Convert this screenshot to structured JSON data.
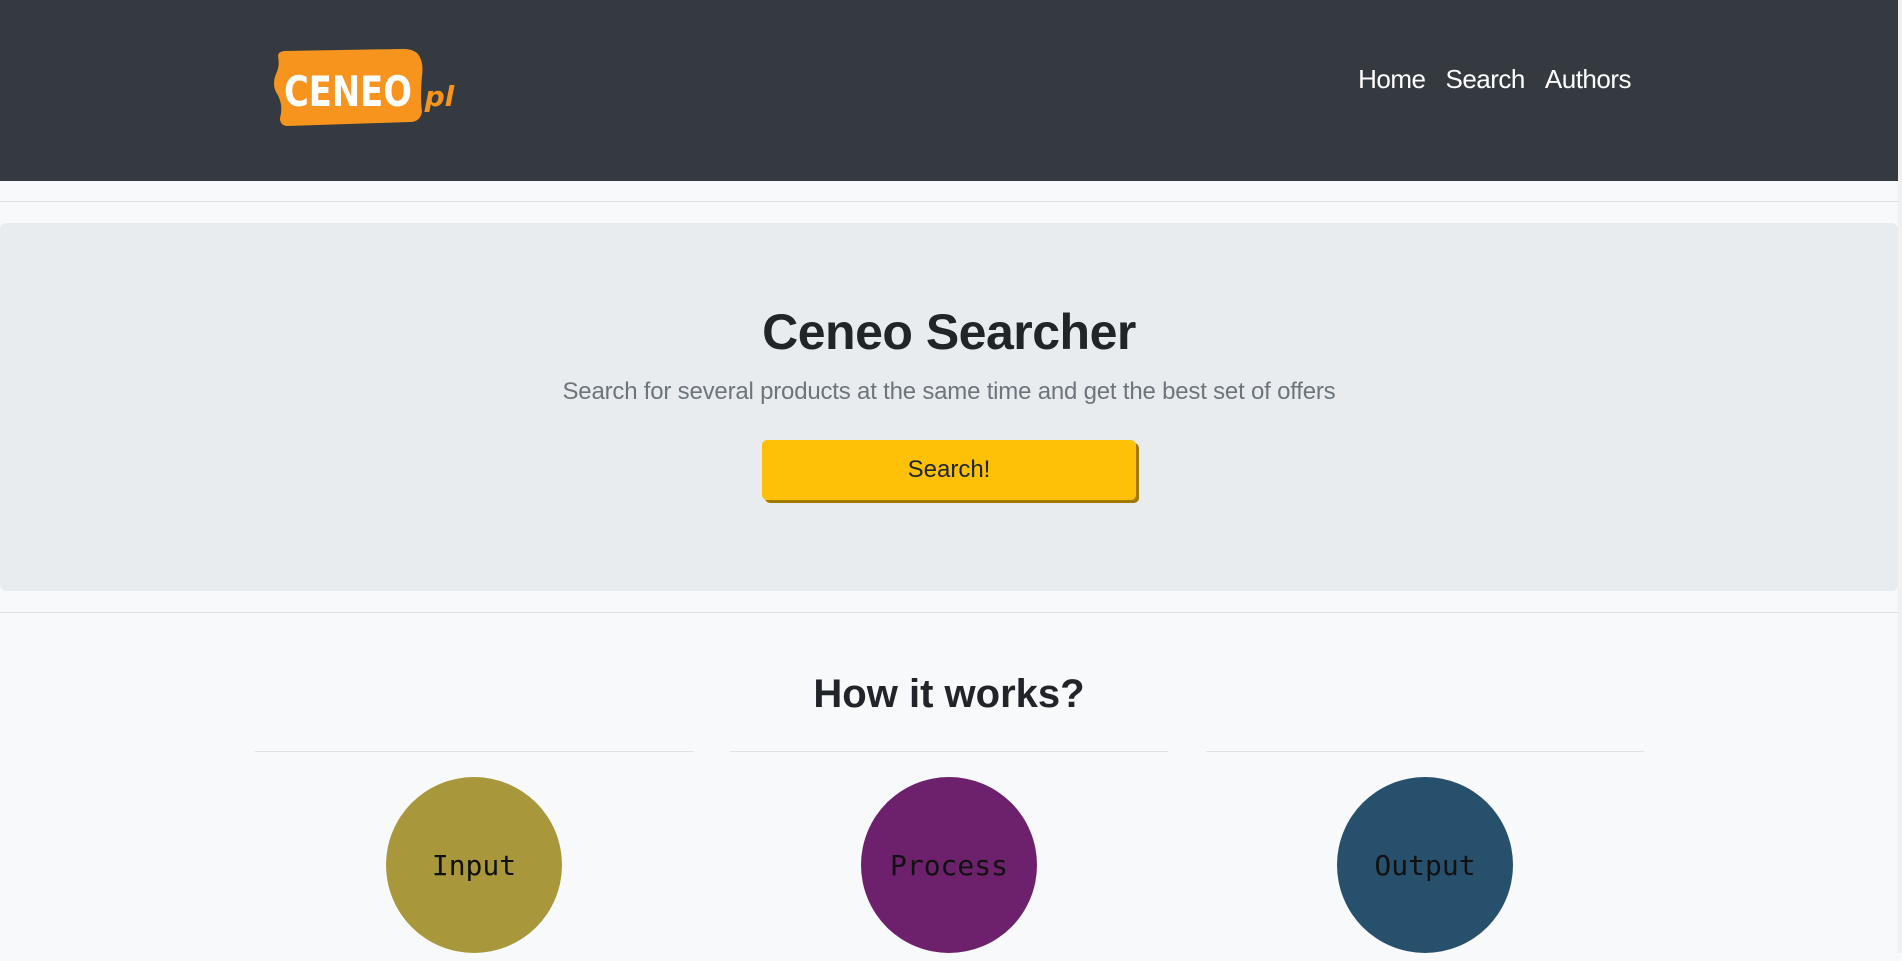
{
  "header": {
    "logo_text": "CENEO",
    "logo_suffix": ".pl",
    "nav": [
      "Home",
      "Search",
      "Authors"
    ]
  },
  "hero": {
    "title": "Ceneo Searcher",
    "subtitle": "Search for several products at the same time and get the best set of offers",
    "button_label": "Search!"
  },
  "how_it_works": {
    "title": "How it works?",
    "steps": [
      {
        "label": "Input",
        "color": "#a9973b"
      },
      {
        "label": "Process",
        "color": "#6d216c"
      },
      {
        "label": "Output",
        "color": "#27506d"
      }
    ]
  },
  "colors": {
    "navbar": "#343a40",
    "accent": "#ffc107",
    "logo": "#f7941d"
  }
}
